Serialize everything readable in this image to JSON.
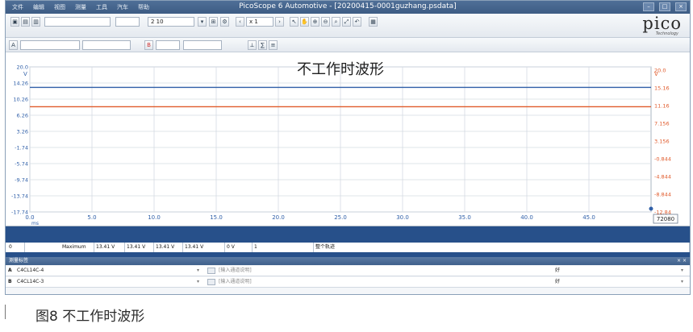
{
  "window": {
    "title": "PicoScope 6 Automotive - [20200415-0001guzhang.psdata]",
    "menu": [
      "文件",
      "编辑",
      "视图",
      "测量",
      "工具",
      "汽车",
      "帮助"
    ]
  },
  "toolbar": {
    "timebase_value": "2 10",
    "zoom_value": "x 1",
    "brand": "pico",
    "brand_sub": "Technology"
  },
  "plot": {
    "annotation": "不工作时波形",
    "left_axis_unit": "V",
    "right_axis_unit": "V",
    "x_unit": "ms",
    "cursor_readout": "72080",
    "left_ticks": [
      "20.0",
      "14.26",
      "10.26",
      "6.26",
      "3.26",
      "-1.74",
      "-5.74",
      "-9.74",
      "-13.74",
      "-17.74"
    ],
    "right_ticks": [
      "20.0",
      "15.16",
      "11.16",
      "7.156",
      "3.156",
      "-0.844",
      "-4.844",
      "-8.844",
      "-12.84"
    ],
    "x_ticks": [
      "0.0",
      "5.0",
      "10.0",
      "15.0",
      "20.0",
      "25.0",
      "30.0",
      "35.0",
      "40.0",
      "45.0"
    ],
    "colors": {
      "channel_a": "#2f5fa8",
      "channel_b": "#e05a2b",
      "grid": "#d5dbe3"
    }
  },
  "chart_data": {
    "type": "line",
    "x": [
      0,
      5,
      10,
      15,
      20,
      25,
      30,
      35,
      40,
      45,
      50
    ],
    "xlim": [
      0,
      50
    ],
    "ylim": [
      -17.74,
      20
    ],
    "series": [
      {
        "values": [
          13.41,
          13.41,
          13.41,
          13.41,
          13.41,
          13.41,
          13.41,
          13.41,
          13.41,
          13.41,
          13.41
        ]
      },
      {
        "values": [
          13.41,
          13.41,
          13.41,
          13.41,
          13.41,
          13.41,
          13.41,
          13.41,
          13.41,
          13.41,
          13.41
        ]
      }
    ]
  },
  "measurements": {
    "row_index": "0",
    "cells": [
      "Maximum",
      "13.41 V",
      "13.41 V",
      "13.41 V",
      "13.41 V",
      "0 V",
      "1",
      "整个轨迹"
    ]
  },
  "channels_panel": {
    "title": "测量标签",
    "rows": [
      {
        "letter": "A",
        "name": "C4CL14C-4",
        "placeholder": "[输入通道说明]",
        "status": "好"
      },
      {
        "letter": "B",
        "name": "C4CL14C-3",
        "placeholder": "[输入通道说明]",
        "status": "好"
      }
    ]
  },
  "caption": "图8   不工作时波形"
}
